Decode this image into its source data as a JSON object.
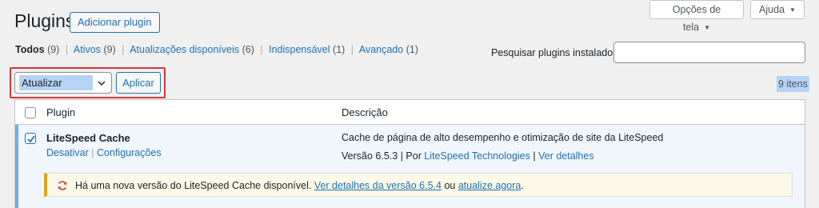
{
  "header": {
    "title": "Plugins",
    "add_button": "Adicionar plugin",
    "screen_options": "Opções de tela",
    "help": "Ajuda"
  },
  "filters": {
    "all": {
      "label": "Todos",
      "count": "(9)"
    },
    "active": {
      "label": "Ativos",
      "count": "(9)"
    },
    "updates": {
      "label": "Atualizações disponíveis",
      "count": "(6)"
    },
    "mustuse": {
      "label": "Indispensável",
      "count": "(1)"
    },
    "dropins": {
      "label": "Avançado",
      "count": "(1)"
    }
  },
  "search": {
    "label": "Pesquisar plugins instalados",
    "value": "",
    "placeholder": ""
  },
  "bulk": {
    "selected": "Atualizar",
    "apply": "Aplicar"
  },
  "items_count": "9 itens",
  "table": {
    "col_plugin": "Plugin",
    "col_description": "Descrição"
  },
  "plugin": {
    "name": "LiteSpeed Cache",
    "deactivate": "Desativar",
    "settings": "Configurações",
    "description": "Cache de página de alto desempenho e otimização de site da LiteSpeed",
    "version": "Versão 6.5.3",
    "by": "Por",
    "author": "LiteSpeed Technologies",
    "details": "Ver detalhes",
    "checked": true
  },
  "notice": {
    "text_before": "Há uma nova versão do LiteSpeed Cache disponível.",
    "details_link": "Ver detalhes da versão 6.5.4",
    "or": "ou",
    "update_link": "atualize agora",
    "end": "."
  },
  "colors": {
    "link": "#2271b1",
    "highlight_border": "#d63638",
    "notice_border": "#dba617",
    "update_icon": "#d63638",
    "selection": "#b4d3f5"
  }
}
